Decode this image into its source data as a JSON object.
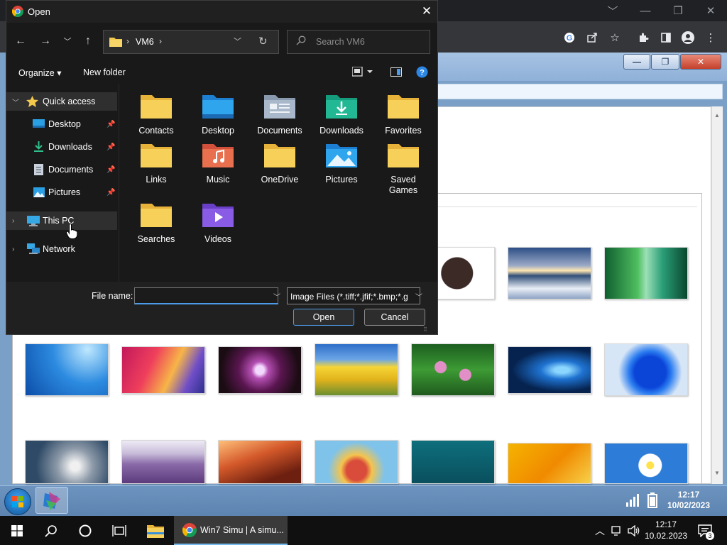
{
  "browser": {
    "minimize_glyph": "﹀",
    "controls": [
      "—",
      "❐",
      "✕"
    ],
    "toolbar_icons": [
      "google-icon",
      "share-icon",
      "star-icon",
      "extensions-icon",
      "sidepanel-icon",
      "profile-icon",
      "menu-icon"
    ]
  },
  "simulator": {
    "window_buttons": [
      "—",
      "❐",
      "✕"
    ],
    "clock": {
      "time": "12:17",
      "date": "10/02/2023"
    }
  },
  "dialog": {
    "title": "Open",
    "path": [
      "VM6"
    ],
    "search_placeholder": "Search VM6",
    "organize_label": "Organize ▾",
    "new_folder_label": "New folder",
    "nav": {
      "quick_access": "Quick access",
      "pinned": [
        "Desktop",
        "Downloads",
        "Documents",
        "Pictures"
      ],
      "this_pc": "This PC",
      "network": "Network"
    },
    "files": [
      "Contacts",
      "Desktop",
      "Documents",
      "Downloads",
      "Favorites",
      "Links",
      "Music",
      "OneDrive",
      "Pictures",
      "Saved Games",
      "Searches",
      "Videos"
    ],
    "file_name_label": "File name:",
    "file_name_value": "",
    "file_type": "Image Files (*.tiff;*.jfif;*.bmp;*.g",
    "open_label": "Open",
    "cancel_label": "Cancel"
  },
  "taskbar": {
    "app_label": "Win7 Simu | A simu...",
    "clock": {
      "time": "12:17",
      "date": "10.02.2023"
    },
    "notification_count": "3"
  },
  "colors": {
    "accent": "#4c9be8",
    "folder_yellow": "#f3c94c",
    "selection": "#2f2f2f"
  }
}
